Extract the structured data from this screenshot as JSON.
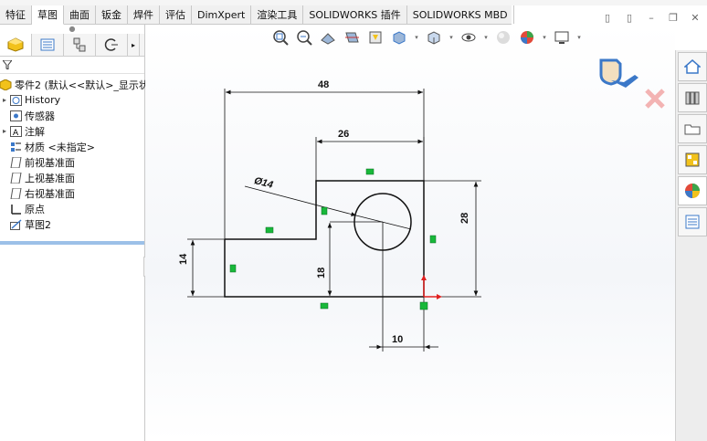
{
  "tabs": [
    "特征",
    "草图",
    "曲面",
    "钣金",
    "焊件",
    "评估",
    "DimXpert",
    "渲染工具",
    "SOLIDWORKS 插件",
    "SOLIDWORKS MBD"
  ],
  "active_tab": "草图",
  "feature_tree": {
    "part": "零件2 (默认<<默认>_显示状",
    "items": [
      {
        "label": "History",
        "icon": "history-icon",
        "expandable": true
      },
      {
        "label": "传感器",
        "icon": "sensor-icon",
        "expandable": false
      },
      {
        "label": "注解",
        "icon": "annotation-icon",
        "expandable": true
      },
      {
        "label": "材质 <未指定>",
        "icon": "material-icon",
        "expandable": false
      },
      {
        "label": "前视基准面",
        "icon": "plane-icon",
        "expandable": false
      },
      {
        "label": "上视基准面",
        "icon": "plane-icon",
        "expandable": false
      },
      {
        "label": "右视基准面",
        "icon": "plane-icon",
        "expandable": false
      },
      {
        "label": "原点",
        "icon": "origin-icon",
        "expandable": false
      },
      {
        "label": "草图2",
        "icon": "sketch-icon",
        "expandable": false
      }
    ]
  },
  "dimensions": {
    "overall_width": "48",
    "top_width": "26",
    "height_right": "28",
    "height_left": "14",
    "hole_y": "18",
    "hole_x": "10",
    "hole_diameter": "Ø14"
  },
  "colors": {
    "accent_blue": "#3b78c8",
    "relation_green": "#18b83a",
    "origin_red": "#e02020"
  }
}
